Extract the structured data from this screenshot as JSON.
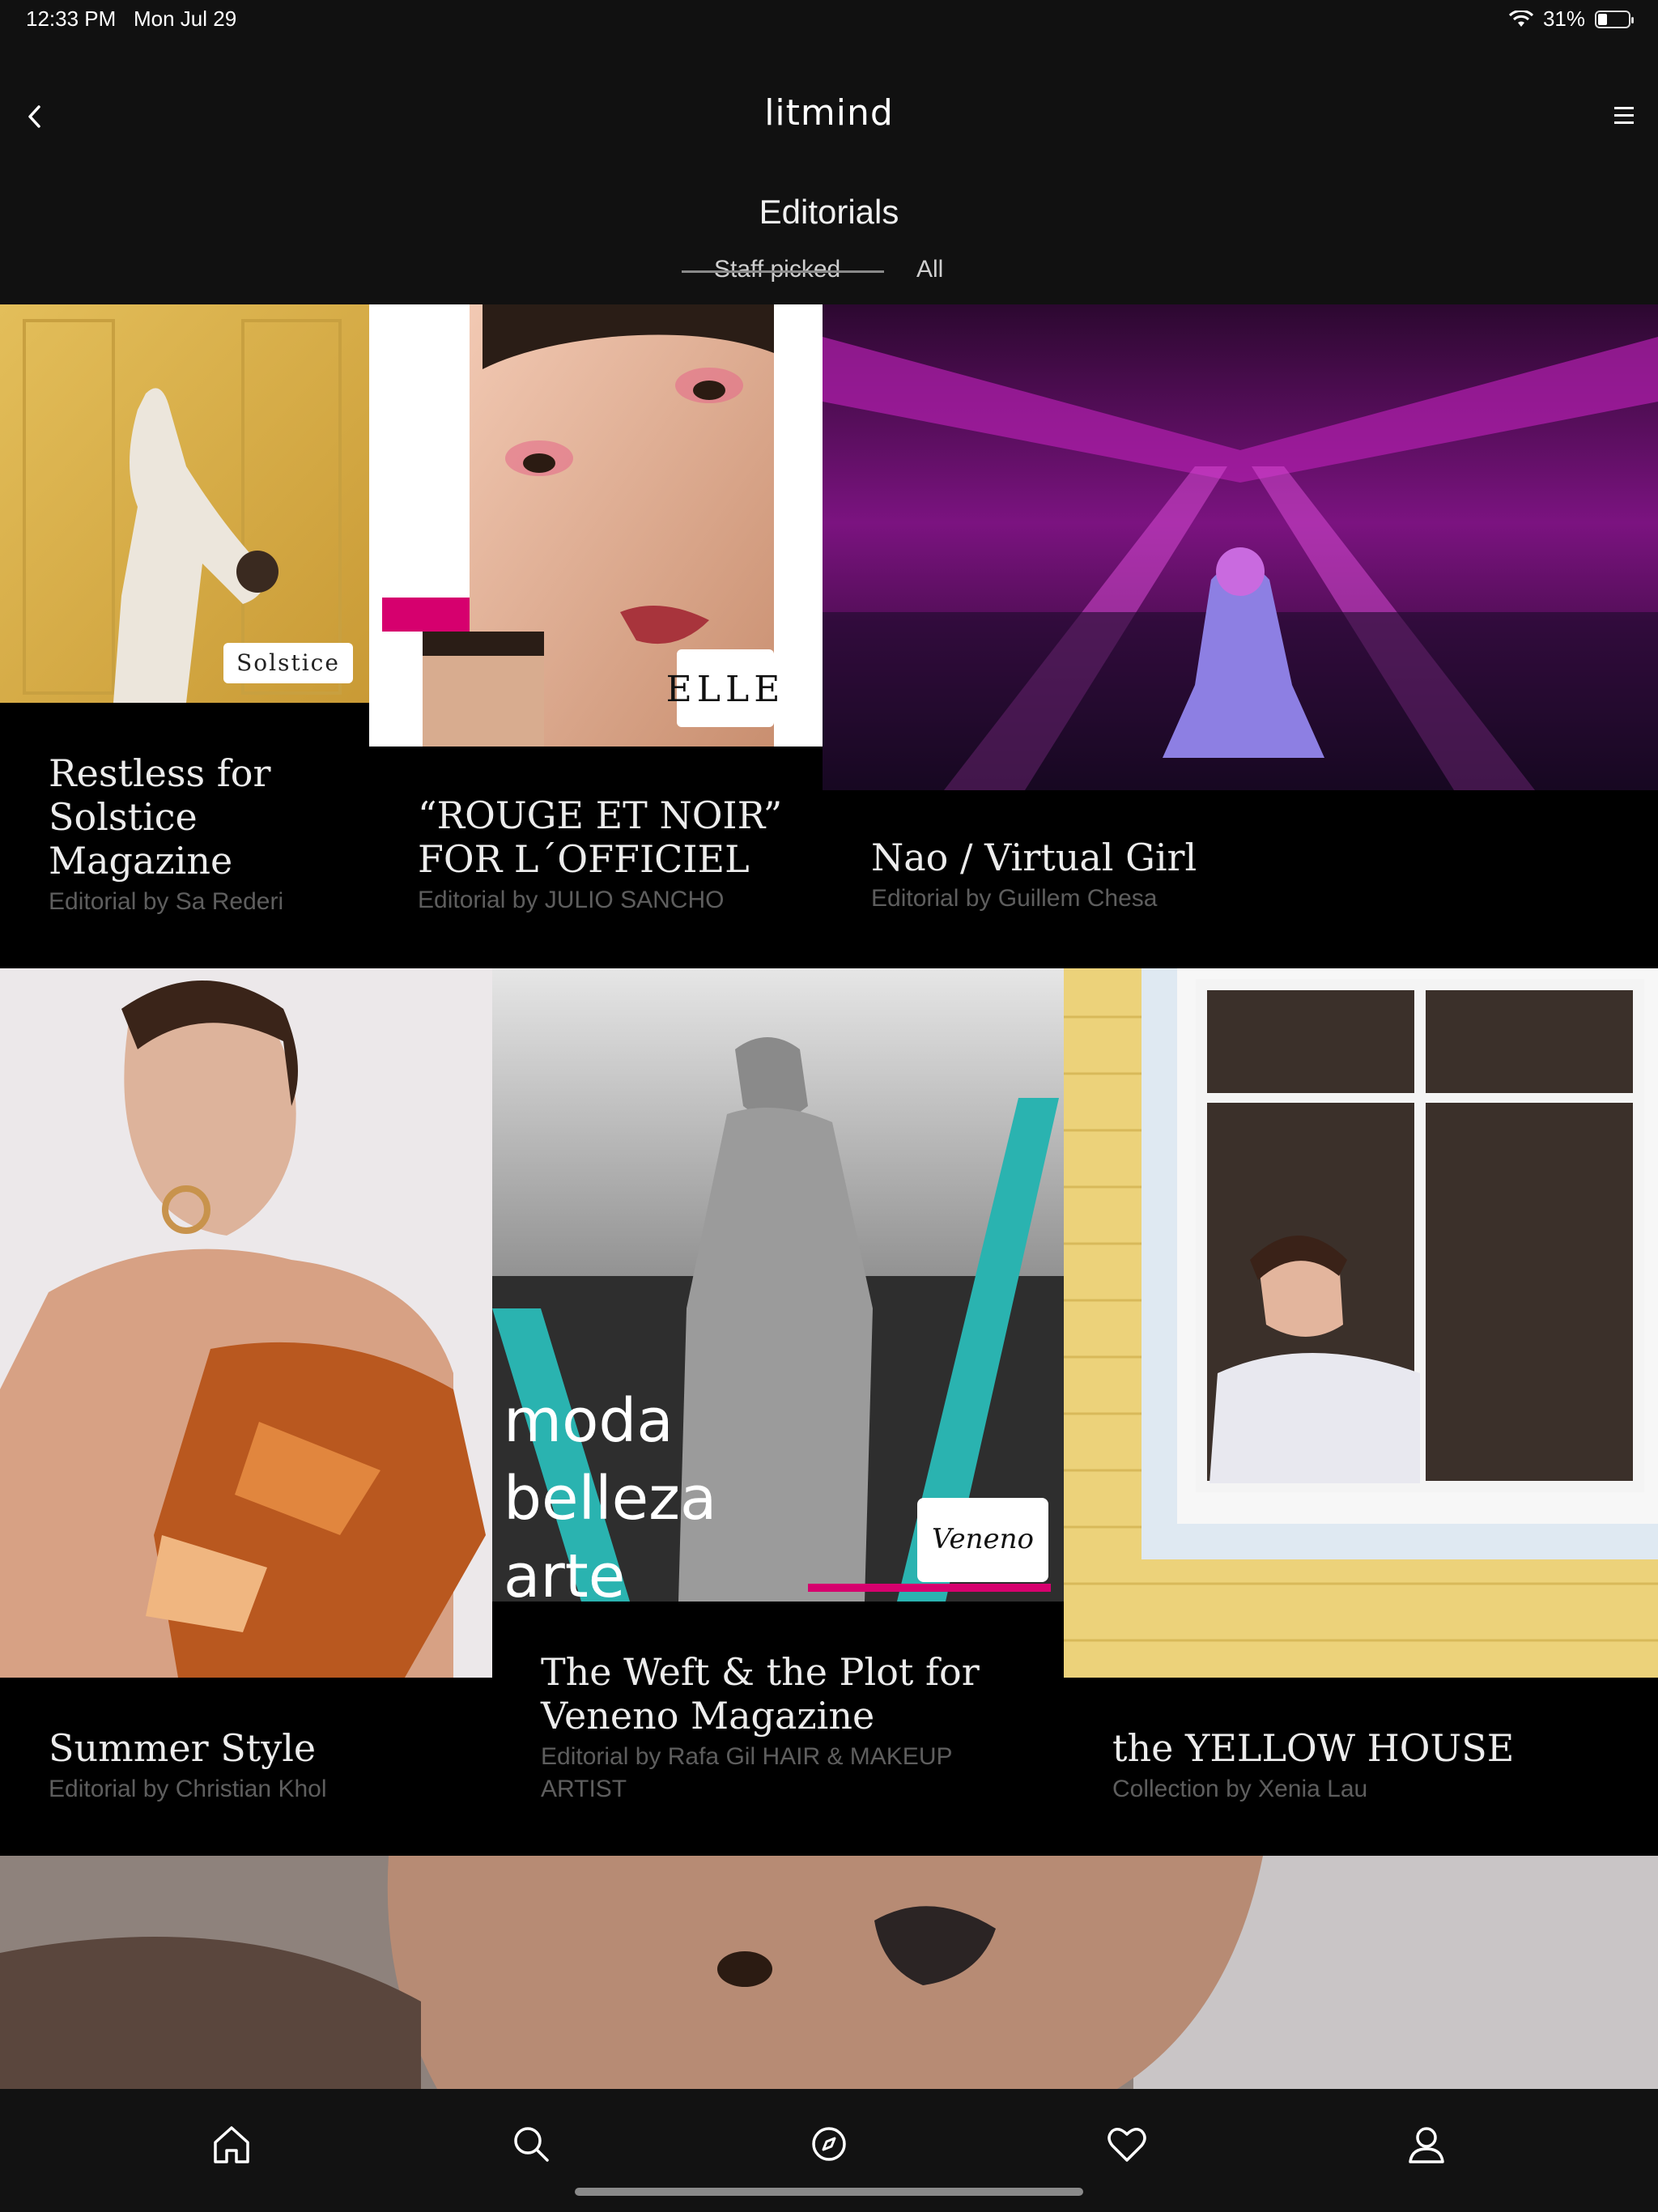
{
  "status_bar": {
    "time": "12:33 PM",
    "date": "Mon Jul 29",
    "battery": "31%",
    "battery_level": 0.31
  },
  "header": {
    "logo": "litmind",
    "title": "Editorials",
    "tabs": [
      {
        "label": "Staff picked",
        "selected": true
      },
      {
        "label": "All",
        "selected": false
      }
    ]
  },
  "cards": [
    {
      "title": "Restless for Solstice Magazine",
      "subtitle": "Editorial by Sa Rederi",
      "badge": "Solstice"
    },
    {
      "title": "“ROUGE ET NOIR” FOR L´OFFICIEL",
      "subtitle": "Editorial by JULIO SANCHO",
      "badge": "ELLE"
    },
    {
      "title": "Nao / Virtual Girl",
      "subtitle": "Editorial by Guillem Chesa"
    },
    {
      "title": "Summer Style",
      "subtitle": "Editorial by Christian Khol"
    },
    {
      "title": "The Weft & the Plot for Veneno Magazine",
      "subtitle": "Editorial by Rafa Gil HAIR & MAKEUP ARTIST",
      "overlay_lines": [
        "moda",
        "belleza",
        "arte"
      ],
      "badge": "Veneno"
    },
    {
      "title": "the YELLOW HOUSE",
      "subtitle": "Collection by Xenia Lau"
    }
  ],
  "bottom_nav": [
    "home-icon",
    "search-icon",
    "compass-icon",
    "heart-icon",
    "profile-icon"
  ],
  "colors": {
    "background": "#050505",
    "header": "#111111",
    "accent_magenta": "#d4006c",
    "accent_teal": "#2ab3b0"
  }
}
